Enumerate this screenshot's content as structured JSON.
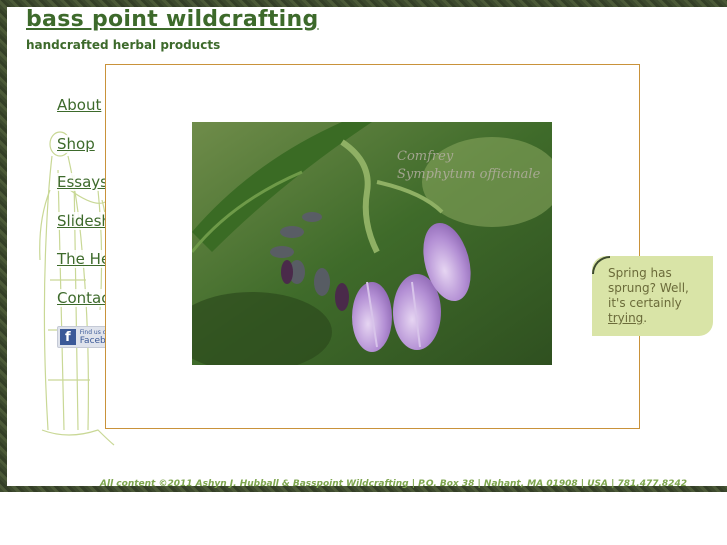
{
  "header": {
    "site_title": "bass point wildcrafting",
    "tagline": "handcrafted herbal products"
  },
  "nav": {
    "items": [
      {
        "label": "About"
      },
      {
        "label": "Shop"
      },
      {
        "label": "Essays"
      },
      {
        "label": "Slideshows"
      },
      {
        "label": "The Herbal"
      },
      {
        "label": "Contact"
      }
    ],
    "facebook": {
      "line1": "Find us on",
      "line2": "Facebook"
    }
  },
  "photo": {
    "watermark_line1": "Comfrey",
    "watermark_line2": "Symphytum officinale"
  },
  "callout": {
    "text": "Spring has sprung? Well, it's certainly ",
    "link_text": "trying",
    "end": "."
  },
  "footer": {
    "text": "All content ©2011 Ashyn J. Hubball & Basspoint Wildcrafting | P.O. Box 38 | Nahant, MA 01908 | USA | 781.477.8242"
  },
  "colors": {
    "accent_green": "#3d6a2b",
    "frame_dark": "#3d4a2e",
    "content_border": "#c9923a",
    "callout_bg": "#d9e4a7"
  }
}
